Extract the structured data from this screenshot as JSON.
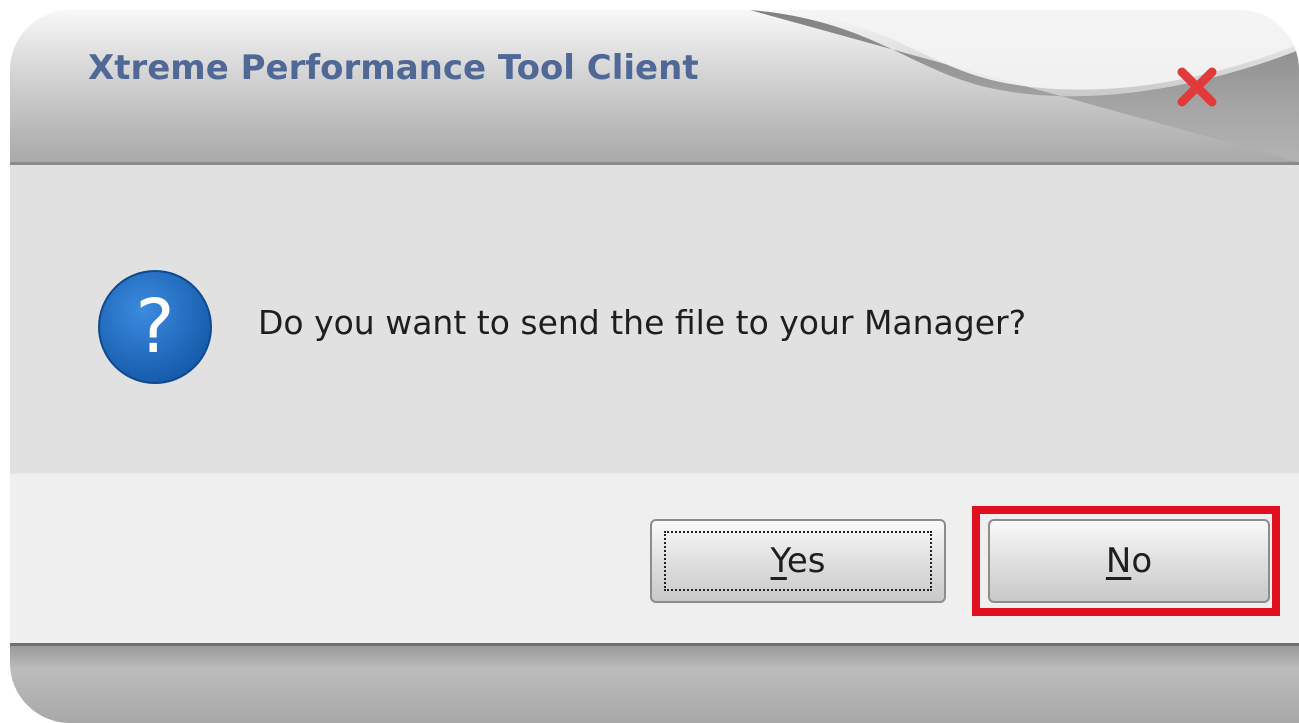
{
  "window": {
    "title": "Xtreme Performance Tool Client"
  },
  "dialog": {
    "message": "Do you want to send the file to your Manager?",
    "icon": "question-icon"
  },
  "buttons": {
    "yes": {
      "accelerator": "Y",
      "rest": "es"
    },
    "no": {
      "accelerator": "N",
      "rest": "o",
      "highlighted": true
    }
  },
  "colors": {
    "title_text": "#4f6896",
    "close_icon": "#e03a3a",
    "question_icon": "#1e6ec3",
    "highlight": "#e01020"
  }
}
